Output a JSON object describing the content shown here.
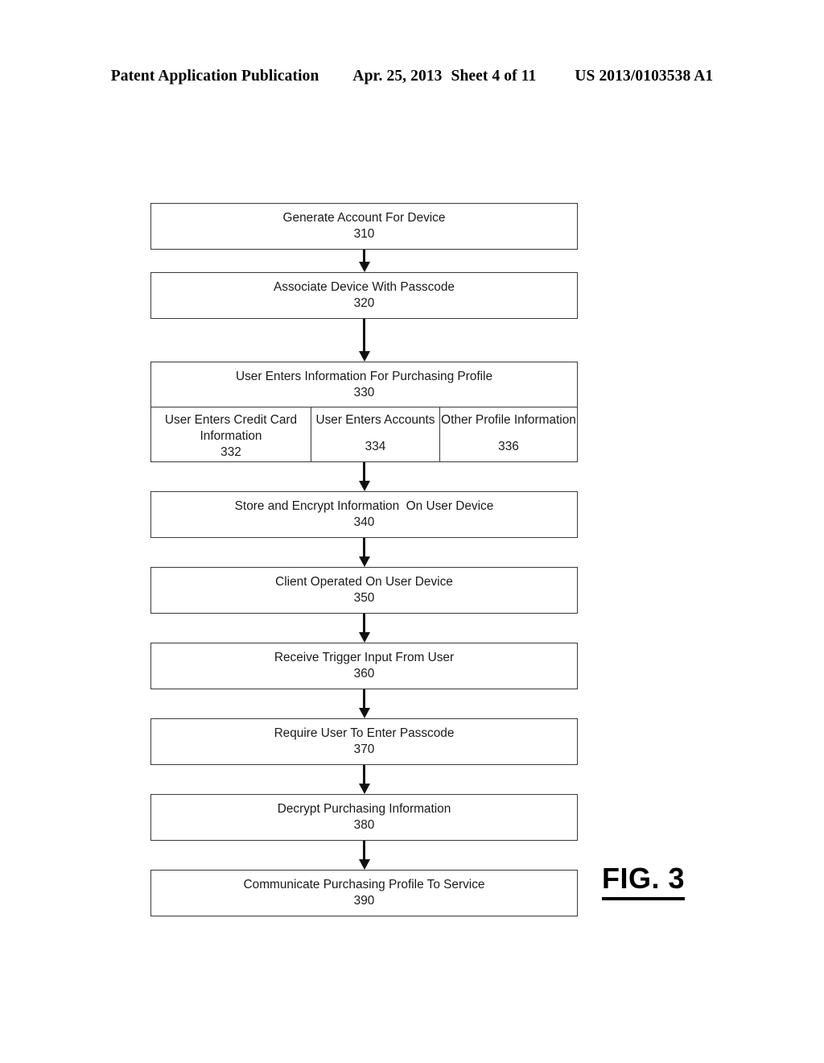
{
  "header": {
    "publication": "Patent Application Publication",
    "date": "Apr. 25, 2013",
    "sheet": "Sheet 4 of 11",
    "number": "US 2013/0103538 A1"
  },
  "figure": {
    "caption": "FIG. 3"
  },
  "flowchart": {
    "type": "flow-diagram",
    "steps": [
      {
        "label": "Generate Account For Device",
        "num": "310"
      },
      {
        "label": "Associate Device With Passcode",
        "num": "320"
      },
      {
        "label": "User Enters Information For Purchasing Profile",
        "num": "330"
      },
      {
        "label": "Store and Encrypt Information  On User Device",
        "num": "340"
      },
      {
        "label": "Client Operated On User Device",
        "num": "350"
      },
      {
        "label": "Receive Trigger Input From User",
        "num": "360"
      },
      {
        "label": "Require User To Enter Passcode",
        "num": "370"
      },
      {
        "label": "Decrypt Purchasing Information",
        "num": "380"
      },
      {
        "label": "Communicate Purchasing Profile To Service",
        "num": "390"
      }
    ],
    "substeps_330": [
      {
        "line1": "User Enters Credit Card",
        "line2": "Information",
        "num": "332"
      },
      {
        "line1": "User Enters Accounts",
        "line2": "",
        "num": "334"
      },
      {
        "line1": "Other Profile Information",
        "line2": "",
        "num": "336"
      }
    ]
  }
}
